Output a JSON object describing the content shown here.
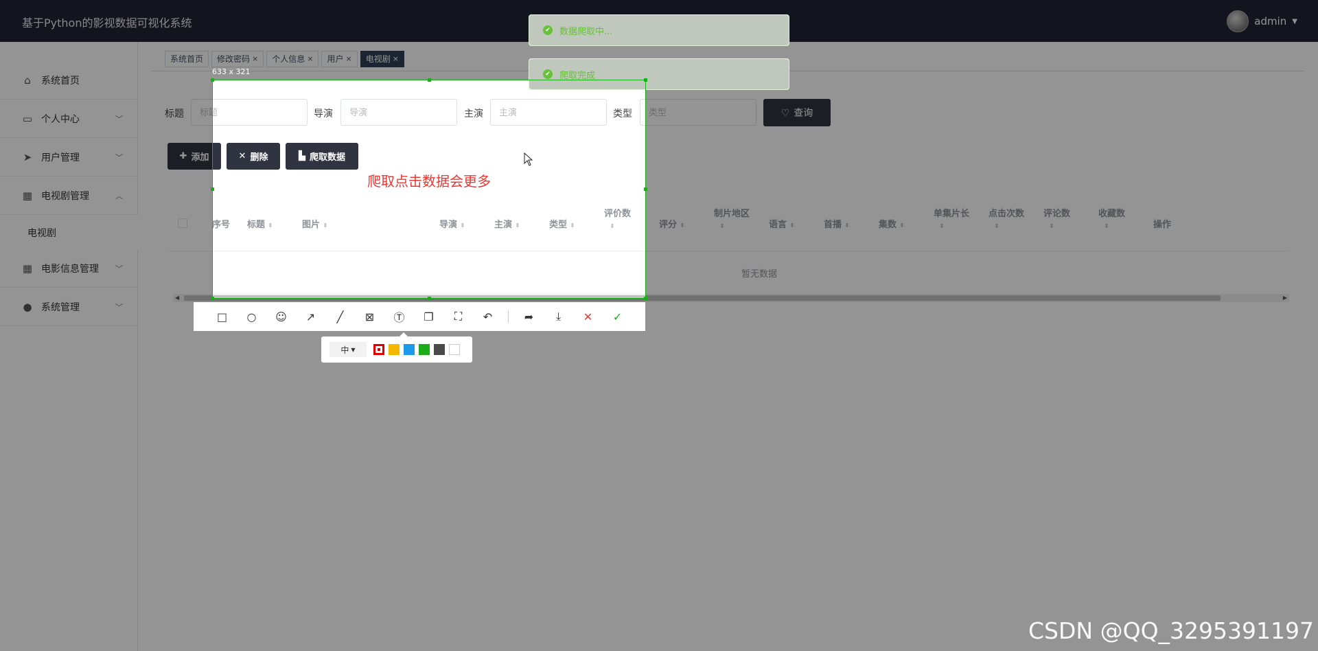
{
  "header": {
    "app_title": "基于Python的影视数据可视化系统",
    "user_name": "admin"
  },
  "sidebar": {
    "items": [
      {
        "label": "系统首页",
        "icon": "home-icon",
        "arrow": ""
      },
      {
        "label": "个人中心",
        "icon": "id-card-icon",
        "arrow": "﹀"
      },
      {
        "label": "用户管理",
        "icon": "paper-plane-icon",
        "arrow": "﹀"
      },
      {
        "label": "电视剧管理",
        "icon": "grid-icon",
        "arrow": "︿"
      },
      {
        "label": "电影信息管理",
        "icon": "grid-icon",
        "arrow": "﹀"
      },
      {
        "label": "系统管理",
        "icon": "user-icon",
        "arrow": "﹀"
      }
    ],
    "sub_item": "电视剧"
  },
  "tabs": [
    {
      "label": "系统首页",
      "closable": false
    },
    {
      "label": "修改密码",
      "closable": true
    },
    {
      "label": "个人信息",
      "closable": true
    },
    {
      "label": "用户",
      "closable": true
    },
    {
      "label": "电视剧",
      "closable": true,
      "active": true
    }
  ],
  "tab_close_glyph": "×",
  "search": {
    "title_label": "标题",
    "title_placeholder": "标题",
    "director_label": "导演",
    "director_placeholder": "导演",
    "actor_label": "主演",
    "actor_placeholder": "主演",
    "type_label": "类型",
    "type_placeholder": "类型",
    "query_label": "查询"
  },
  "actions": {
    "add_label": "添加",
    "delete_label": "删除",
    "crawl_label": "爬取数据"
  },
  "table": {
    "columns": [
      "序号",
      "标题",
      "图片",
      "导演",
      "主演",
      "类型",
      "评价数",
      "评分",
      "制片地区",
      "语言",
      "首播",
      "集数",
      "单集片长",
      "点击次数",
      "评论数",
      "收藏数",
      "操作"
    ],
    "empty_text": "暂无数据"
  },
  "toasts": [
    "数据爬取中...",
    "爬取完成"
  ],
  "capture": {
    "size_text": "633 x 321",
    "annotation": "爬取点击数据会更多",
    "font_size_option": "中",
    "colors": [
      "#e00000",
      "#f5b800",
      "#1e9be8",
      "#1aad19",
      "#4a4a4a",
      "#ffffff"
    ]
  },
  "watermark": "CSDN @QQ_3295391197"
}
